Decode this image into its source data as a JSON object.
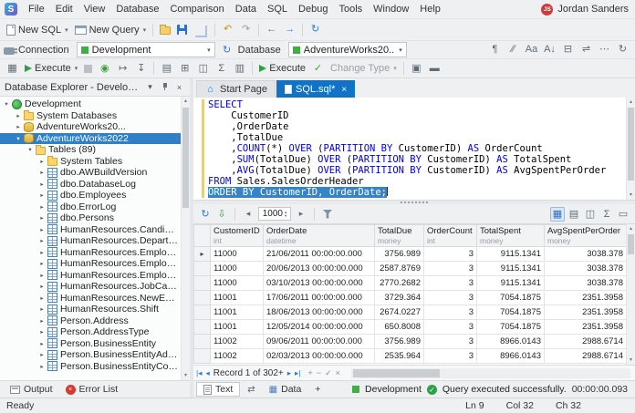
{
  "app": {
    "logo_letter": "S",
    "user": {
      "initials": "JS",
      "name": "Jordan Sanders"
    }
  },
  "menubar": {
    "items": [
      "File",
      "Edit",
      "View",
      "Database",
      "Comparison",
      "Data",
      "SQL",
      "Debug",
      "Tools",
      "Window",
      "Help"
    ]
  },
  "toolbar_standard": {
    "buttons": [
      {
        "name": "new-sql",
        "icon": "doc-sql",
        "label": "New SQL",
        "dd": true
      },
      {
        "name": "new-query",
        "icon": "query-window",
        "label": "New Query",
        "dd": true
      },
      {
        "sep": true
      },
      {
        "name": "open-file",
        "icon": "folder-open"
      },
      {
        "name": "save",
        "icon": "save"
      },
      {
        "name": "save-all",
        "icon": "save-all"
      },
      {
        "sep": true
      },
      {
        "name": "undo",
        "icon": "glyph",
        "glyph": "↶",
        "color": "#d98c00"
      },
      {
        "name": "redo",
        "icon": "glyph",
        "glyph": "↷",
        "color": "#98a0a6"
      },
      {
        "sep": true
      },
      {
        "name": "navigate-backward",
        "icon": "glyph",
        "glyph": "←",
        "color": "#2d7dd2"
      },
      {
        "name": "navigate-forward",
        "icon": "glyph",
        "glyph": "→",
        "color": "#2d7dd2"
      },
      {
        "sep": true
      },
      {
        "name": "refresh-document",
        "icon": "glyph",
        "glyph": "↻",
        "color": "#2d7dd2"
      }
    ]
  },
  "toolbar_connection": {
    "connection_label": "Connection",
    "connection_value": "Development",
    "database_label": "Database",
    "database_value": "AdventureWorks20...",
    "right_buttons": [
      {
        "name": "format-sql",
        "icon": "glyph",
        "glyph": "¶",
        "color": "#5f6b76"
      },
      {
        "name": "comment-lines",
        "icon": "glyph",
        "glyph": "∕∕",
        "color": "#5f6b76"
      },
      {
        "name": "toggle-case",
        "icon": "glyph",
        "glyph": "Aa",
        "color": "#5f6b76"
      },
      {
        "name": "sort-lines",
        "icon": "glyph",
        "glyph": "A↓",
        "color": "#5f6b76"
      },
      {
        "name": "outline-collapse",
        "icon": "glyph",
        "glyph": "⊟",
        "color": "#5f6b76"
      },
      {
        "name": "word-wrap",
        "icon": "glyph",
        "glyph": "⇌",
        "color": "#5f6b76"
      },
      {
        "name": "show-whitespace",
        "icon": "glyph",
        "glyph": "⋯",
        "color": "#5f6b76"
      },
      {
        "name": "refresh-cache",
        "icon": "glyph",
        "glyph": "↻",
        "color": "#5f6b76"
      }
    ]
  },
  "toolbar_execute": {
    "buttons": [
      {
        "name": "results-mode",
        "icon": "glyph",
        "glyph": "▦",
        "color": "#5f6b76"
      },
      {
        "name": "execute",
        "icon": "play",
        "label": "Execute",
        "dd": true
      },
      {
        "name": "stop-execution",
        "icon": "stop",
        "disabled": true
      },
      {
        "name": "debug",
        "icon": "glyph",
        "glyph": "◉",
        "color": "#3f9e3f"
      },
      {
        "name": "step-over",
        "icon": "glyph",
        "glyph": "↦",
        "color": "#5f6b76"
      },
      {
        "name": "step-into",
        "icon": "glyph",
        "glyph": "↧",
        "color": "#5f6b76"
      },
      {
        "sep": true
      },
      {
        "name": "query-profiler",
        "icon": "glyph",
        "glyph": "▤",
        "color": "#5f6b76"
      },
      {
        "name": "execution-plan",
        "icon": "glyph",
        "glyph": "⊞",
        "color": "#5f6b76"
      },
      {
        "name": "pivot-table",
        "icon": "glyph",
        "glyph": "◫",
        "color": "#5f6b76"
      },
      {
        "name": "aggregates",
        "icon": "glyph",
        "glyph": "Σ",
        "color": "#5f6b76"
      },
      {
        "name": "document-outline",
        "icon": "glyph",
        "glyph": "▥",
        "color": "#5f6b76"
      },
      {
        "sep": true
      },
      {
        "name": "execute-statement",
        "icon": "play",
        "label": "Execute"
      },
      {
        "name": "parse-sql",
        "icon": "glyph",
        "glyph": "✓",
        "color": "#3f9e3f"
      },
      {
        "name": "change-type",
        "label": "Change Type",
        "dd": true,
        "disabled": true
      },
      {
        "sep": true
      },
      {
        "name": "query-options",
        "icon": "glyph",
        "glyph": "▣",
        "color": "#5f6b76"
      },
      {
        "name": "results-layout",
        "icon": "glyph",
        "glyph": "▬",
        "color": "#5f6b76"
      }
    ]
  },
  "explorer": {
    "title": "Database Explorer - Develop...",
    "tree": [
      {
        "label": "Development",
        "lvl": 0,
        "icon": "conn",
        "exp": "open"
      },
      {
        "label": "System Databases",
        "lvl": 1,
        "icon": "folder",
        "exp": "closed"
      },
      {
        "label": "AdventureWorks20...",
        "lvl": 1,
        "icon": "db",
        "exp": "closed"
      },
      {
        "label": "AdventureWorks2022",
        "lvl": 1,
        "icon": "db",
        "exp": "open",
        "selected": true
      },
      {
        "label": "Tables (89)",
        "lvl": 2,
        "icon": "folder",
        "exp": "open"
      },
      {
        "label": "System Tables",
        "lvl": 3,
        "icon": "folder",
        "exp": "closed"
      },
      {
        "label": "dbo.AWBuildVersion",
        "lvl": 3,
        "icon": "table",
        "exp": "closed"
      },
      {
        "label": "dbo.DatabaseLog",
        "lvl": 3,
        "icon": "table",
        "exp": "closed"
      },
      {
        "label": "dbo.Employees",
        "lvl": 3,
        "icon": "table",
        "exp": "closed"
      },
      {
        "label": "dbo.ErrorLog",
        "lvl": 3,
        "icon": "table",
        "exp": "closed"
      },
      {
        "label": "dbo.Persons",
        "lvl": 3,
        "icon": "table",
        "exp": "closed"
      },
      {
        "label": "HumanResources.Candidate",
        "lvl": 3,
        "icon": "table",
        "exp": "closed"
      },
      {
        "label": "HumanResources.Department",
        "lvl": 3,
        "icon": "table",
        "exp": "closed"
      },
      {
        "label": "HumanResources.Employee",
        "lvl": 3,
        "icon": "table",
        "exp": "closed"
      },
      {
        "label": "HumanResources.EmployeeDepartmentHistory",
        "lvl": 3,
        "icon": "table",
        "exp": "closed"
      },
      {
        "label": "HumanResources.EmployeePayHistory",
        "lvl": 3,
        "icon": "table",
        "exp": "closed"
      },
      {
        "label": "HumanResources.JobCandidate",
        "lvl": 3,
        "icon": "table",
        "exp": "closed"
      },
      {
        "label": "HumanResources.NewEmployee",
        "lvl": 3,
        "icon": "table",
        "exp": "closed"
      },
      {
        "label": "HumanResources.Shift",
        "lvl": 3,
        "icon": "table",
        "exp": "closed"
      },
      {
        "label": "Person.Address",
        "lvl": 3,
        "icon": "table",
        "exp": "closed"
      },
      {
        "label": "Person.AddressType",
        "lvl": 3,
        "icon": "table",
        "exp": "closed"
      },
      {
        "label": "Person.BusinessEntity",
        "lvl": 3,
        "icon": "table",
        "exp": "closed"
      },
      {
        "label": "Person.BusinessEntityAddress",
        "lvl": 3,
        "icon": "table",
        "exp": "closed"
      },
      {
        "label": "Person.BusinessEntityContact",
        "lvl": 3,
        "icon": "table",
        "exp": "closed"
      }
    ]
  },
  "document_tabs": [
    {
      "label": "Start Page"
    },
    {
      "label": "SQL.sql*",
      "active": true
    }
  ],
  "editor": {
    "lines": [
      {
        "tok": [
          [
            "SELECT",
            "kw"
          ]
        ]
      },
      {
        "tok": [
          [
            "    CustomerID",
            "id"
          ]
        ]
      },
      {
        "tok": [
          [
            "    ,",
            "pl"
          ],
          [
            "OrderDate",
            "id"
          ]
        ]
      },
      {
        "tok": [
          [
            "    ,",
            "pl"
          ],
          [
            "TotalDue",
            "id"
          ]
        ]
      },
      {
        "tok": [
          [
            "    ,",
            "pl"
          ],
          [
            "COUNT",
            "kw"
          ],
          [
            "(*) ",
            "pl"
          ],
          [
            "OVER",
            "kw"
          ],
          [
            " (",
            "pl"
          ],
          [
            "PARTITION BY",
            "kw"
          ],
          [
            " CustomerID",
            "id"
          ],
          [
            ") ",
            "pl"
          ],
          [
            "AS",
            "kw"
          ],
          [
            " OrderCount",
            "id"
          ]
        ]
      },
      {
        "tok": [
          [
            "    ,",
            "pl"
          ],
          [
            "SUM",
            "kw"
          ],
          [
            "(",
            "pl"
          ],
          [
            "TotalDue",
            "id"
          ],
          [
            ") ",
            "pl"
          ],
          [
            "OVER",
            "kw"
          ],
          [
            " (",
            "pl"
          ],
          [
            "PARTITION BY",
            "kw"
          ],
          [
            " CustomerID",
            "id"
          ],
          [
            ") ",
            "pl"
          ],
          [
            "AS",
            "kw"
          ],
          [
            " TotalSpent",
            "id"
          ]
        ]
      },
      {
        "tok": [
          [
            "    ,",
            "pl"
          ],
          [
            "AVG",
            "kw"
          ],
          [
            "(",
            "pl"
          ],
          [
            "TotalDue",
            "id"
          ],
          [
            ") ",
            "pl"
          ],
          [
            "OVER",
            "kw"
          ],
          [
            " (",
            "pl"
          ],
          [
            "PARTITION BY",
            "kw"
          ],
          [
            " CustomerID",
            "id"
          ],
          [
            ") ",
            "pl"
          ],
          [
            "AS",
            "kw"
          ],
          [
            " AvgSpentPerOrder",
            "id"
          ]
        ]
      },
      {
        "tok": [
          [
            "FROM",
            "kw"
          ],
          [
            " Sales.SalesOrderHeader",
            "id"
          ]
        ]
      },
      {
        "sel": true,
        "tok": [
          [
            "ORDER BY",
            "kw"
          ],
          [
            " CustomerID, OrderDate;",
            "id"
          ]
        ]
      }
    ]
  },
  "results_toolbar": {
    "page_size": "1000",
    "left_buttons": [
      {
        "name": "refresh-results",
        "glyph": "↻",
        "color": "#2d7dd2"
      },
      {
        "name": "export-data",
        "glyph": "⇩",
        "color": "#3f9e3f"
      }
    ],
    "right_buttons": [
      {
        "name": "grid-view",
        "glyph": "▦",
        "color": "#2d6fc2",
        "active": true
      },
      {
        "name": "text-view",
        "glyph": "▤",
        "color": "#5f6b76"
      },
      {
        "name": "card-view",
        "glyph": "◫",
        "color": "#5f6b76"
      },
      {
        "name": "aggregate-view",
        "glyph": "Σ",
        "color": "#5f6b76"
      },
      {
        "name": "chart-view",
        "glyph": "▭",
        "color": "#5f6b76"
      }
    ]
  },
  "grid": {
    "columns": [
      {
        "name": "CustomerID",
        "type": "int"
      },
      {
        "name": "Or derDate",
        "type": "datetime"
      },
      {
        "name": "TotalDue",
        "type": "money"
      },
      {
        "name": "OrderCount",
        "type": "int"
      },
      {
        "name": "TotalSpent",
        "type": "money"
      },
      {
        "name": "AvgSpentPerOrder",
        "type": "money"
      }
    ],
    "rows": [
      [
        "11000",
        "21/06/2011 00:00:00.000",
        "3756.989",
        "3",
        "9115.1341",
        "3038.378"
      ],
      [
        "11000",
        "20/06/2013 00:00:00.000",
        "2587.8769",
        "3",
        "9115.1341",
        "3038.378"
      ],
      [
        "11000",
        "03/10/2013 00:00:00.000",
        "2770.2682",
        "3",
        "9115.1341",
        "3038.378"
      ],
      [
        "11001",
        "17/06/2011 00:00:00.000",
        "3729.364",
        "3",
        "7054.1875",
        "2351.3958"
      ],
      [
        "11001",
        "18/06/2013 00:00:00.000",
        "2674.0227",
        "3",
        "7054.1875",
        "2351.3958"
      ],
      [
        "11001",
        "12/05/2014 00:00:00.000",
        "650.8008",
        "3",
        "7054.1875",
        "2351.3958"
      ],
      [
        "11002",
        "09/06/2011 00:00:00.000",
        "3756.989",
        "3",
        "8966.0143",
        "2988.6714"
      ],
      [
        "11002",
        "02/03/2013 00:00:00.000",
        "2535.964",
        "3",
        "8966.0143",
        "2988.6714"
      ]
    ],
    "current_row": 0
  },
  "grid_footer": {
    "record_status": "Record 1 of 302+",
    "nav_left": [
      {
        "name": "first-record",
        "glyph": "|◂"
      },
      {
        "name": "prev-record",
        "glyph": "◂"
      }
    ],
    "nav_right": [
      {
        "name": "next-record",
        "glyph": "▸"
      },
      {
        "name": "last-record",
        "glyph": "▸|"
      }
    ],
    "edit_buttons": [
      {
        "name": "append-record",
        "glyph": "+"
      },
      {
        "name": "delete-record",
        "glyph": "−"
      },
      {
        "name": "post-edit",
        "glyph": "✓"
      },
      {
        "name": "cancel-edit",
        "glyph": "×"
      }
    ]
  },
  "doc_bottom": {
    "views": [
      {
        "name": "text-view-tab",
        "label": "Text",
        "icon": "text",
        "active": true
      },
      {
        "name": "compare-view-tab",
        "label": "",
        "icon": "swap"
      },
      {
        "name": "data-view-tab",
        "label": "Data",
        "icon": "grid"
      },
      {
        "name": "add-view-tab",
        "label": "+",
        "icon": "none"
      }
    ],
    "connection": "Development",
    "status_message": "Query executed successfully.",
    "execution_time": "00:00:00.093"
  },
  "bottom_panels": [
    {
      "name": "output",
      "label": "Output",
      "icon": "out"
    },
    {
      "name": "error-list",
      "label": "Error List",
      "icon": "err"
    }
  ],
  "statusbar": {
    "state": "Ready",
    "line": "Ln 9",
    "column": "Col 32",
    "character": "Ch 32"
  }
}
